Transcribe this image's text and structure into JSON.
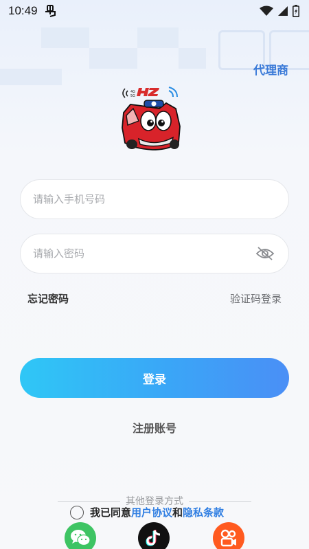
{
  "status_bar": {
    "time": "10:49"
  },
  "header": {
    "agent_link": "代理商"
  },
  "login_form": {
    "phone_placeholder": "请输入手机号码",
    "password_placeholder": "请输入密码",
    "forgot_password": "忘记密码",
    "code_login": "验证码登录",
    "login_button": "登录",
    "register": "注册账号"
  },
  "other_login": {
    "label": "其他登录方式",
    "agreement_prefix": "我已同意",
    "user_agreement": "用户协议",
    "and": "和",
    "privacy_policy": "隐私条款",
    "methods": [
      "wechat-icon",
      "douyin-icon",
      "kuaishou-icon"
    ]
  },
  "colors": {
    "accent": "#3b7bd8",
    "button_start": "#2fc7f6",
    "button_end": "#4a8ff6",
    "wechat": "#3ec463",
    "douyin": "#111111",
    "kuaishou": "#ff5a1f"
  }
}
